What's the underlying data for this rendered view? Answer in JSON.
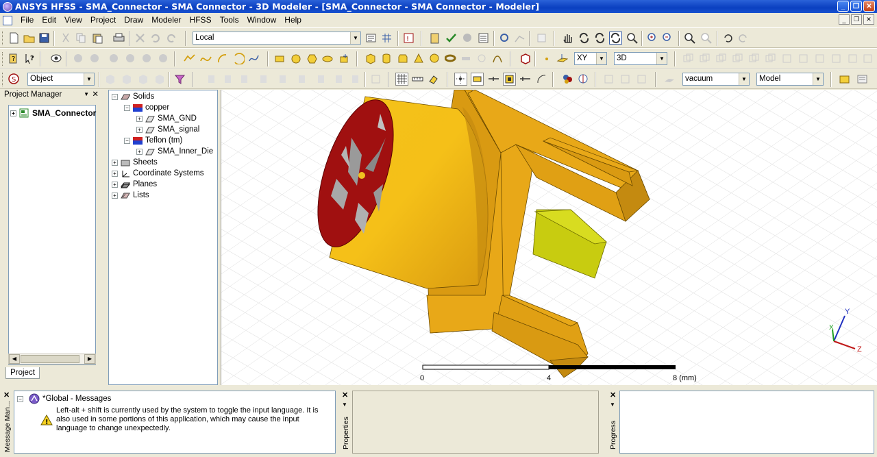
{
  "window": {
    "title": "ANSYS HFSS - SMA_Connector - SMA Connector - 3D Modeler - [SMA_Connector - SMA Connector - Modeler]"
  },
  "menu": [
    "File",
    "Edit",
    "View",
    "Project",
    "Draw",
    "Modeler",
    "HFSS",
    "Tools",
    "Window",
    "Help"
  ],
  "toolbar": {
    "coord_system": "Local",
    "select_mode": "Object",
    "plane": "XY",
    "view_mode": "3D",
    "material": "vacuum",
    "model_type": "Model"
  },
  "project_manager": {
    "header": "Project Manager",
    "project_name": "SMA_Connector",
    "tab": "Project"
  },
  "model_tree": {
    "solids": "Solids",
    "copper": "copper",
    "sma_gnd": "SMA_GND",
    "sma_signal": "SMA_signal",
    "teflon": "Teflon (tm)",
    "sma_inner_die": "SMA_Inner_Die",
    "sheets": "Sheets",
    "coordinate_systems": "Coordinate Systems",
    "planes": "Planes",
    "lists": "Lists"
  },
  "viewport": {
    "scale_labels": [
      "0",
      "4",
      "8 (mm)"
    ],
    "axis_labels": [
      "Y",
      "X",
      "Z"
    ]
  },
  "messages": {
    "side_label": "Message Man...",
    "group": "*Global - Messages",
    "warning": "Left-alt + shift is currently used by the system to toggle the input language. It is also used in some portions of this application, which may cause the input language to change unexpectedly."
  },
  "properties": {
    "side_label": "Properties"
  },
  "progress": {
    "side_label": "Progress"
  },
  "colors": {
    "gold": "#e8a818",
    "gold_dark": "#c48a10",
    "face_red": "#a01010",
    "teflon_yellow": "#c8cc10",
    "title_blue": "#0a3fc0"
  }
}
